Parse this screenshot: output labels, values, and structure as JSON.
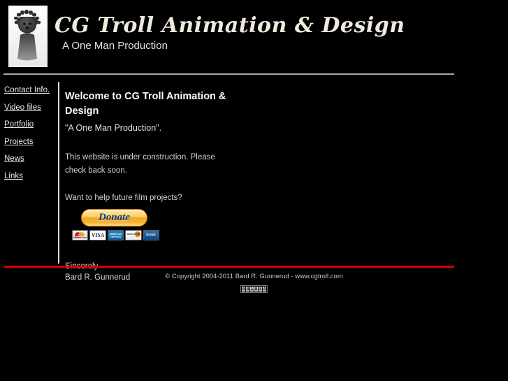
{
  "banner": {
    "logo_alt": "cg-troll-logo",
    "title": "CG Troll Animation & Design",
    "subtitle": "A One Man Production"
  },
  "sidebar": {
    "items": [
      {
        "label": "Contact Info."
      },
      {
        "label": "Video files"
      },
      {
        "label": "Portfolio"
      },
      {
        "label": "Projects"
      },
      {
        "label": "News"
      },
      {
        "label": "Links"
      }
    ]
  },
  "main": {
    "heading": "Welcome to CG Troll Animation & Design",
    "tagline": "\"A One Man Production\".",
    "body": "This website is under construction. Please check back soon.",
    "donate_question": "Want to help future film projects?",
    "donate_button_label": "Donate",
    "cards": [
      {
        "name": "mastercard",
        "label": "MasterCard"
      },
      {
        "name": "visa",
        "label": "VISA"
      },
      {
        "name": "amex",
        "label": "AMERICAN EXPRESS"
      },
      {
        "name": "discover",
        "label": "DISCOVER"
      },
      {
        "name": "bank",
        "label": "BANK"
      }
    ],
    "signoff_line1": "Sincerely",
    "signoff_line2": "Bard R. Gunnerud"
  },
  "footer": {
    "copyright": "© Copyright 2004-2011 Bard R. Gunnerud - www.cgtroll.com",
    "counter_digits": [
      "0",
      "0",
      "1",
      "8",
      "3",
      "4"
    ]
  },
  "colors": {
    "background": "#000000",
    "accent_red": "#d80000",
    "rule_gray": "#a8a8a8",
    "banner_text": "#efeade",
    "donate_orange": "#f5a623",
    "donate_text_blue": "#0b3a8c"
  }
}
